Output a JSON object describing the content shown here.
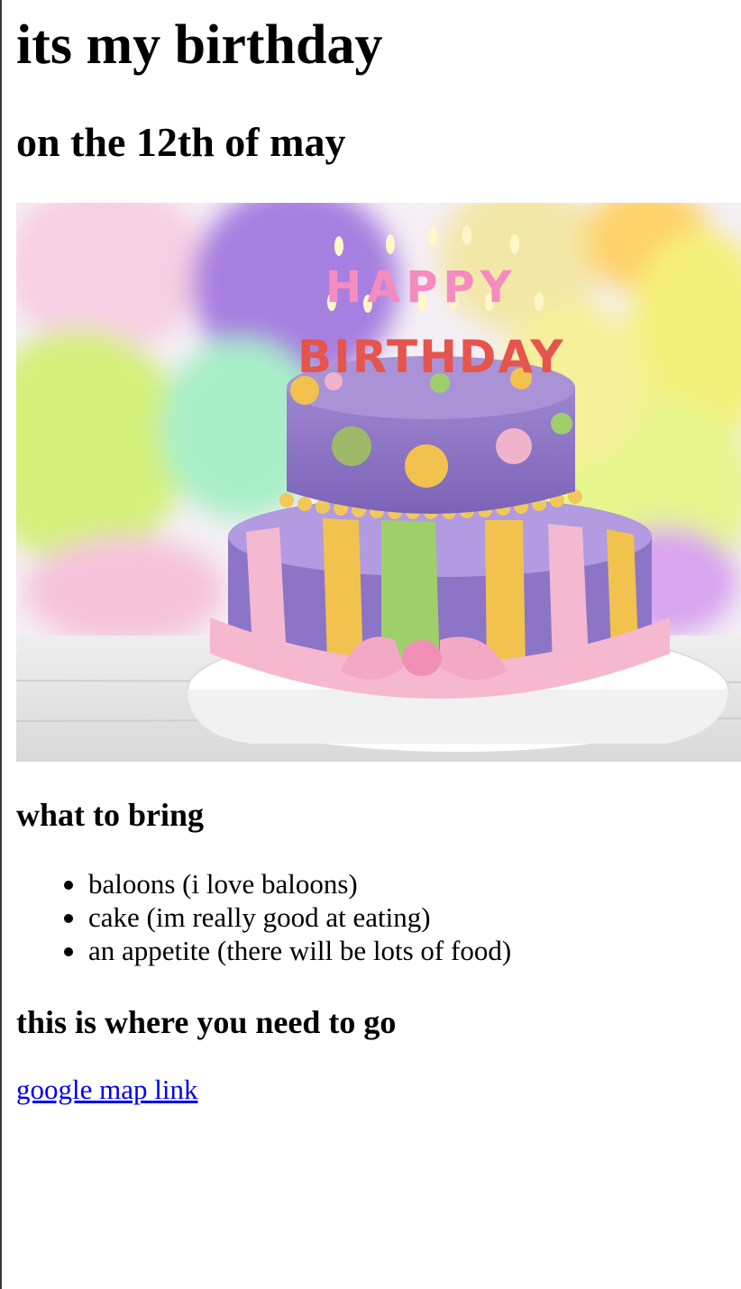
{
  "page": {
    "heading": "its my birthday",
    "subheading": "on the 12th of may"
  },
  "hero_image": {
    "icon": "birthday-cake-photo",
    "alt": "",
    "cake_topper_top": "HAPPY",
    "cake_topper_bottom": "BIRTHDAY"
  },
  "bring": {
    "heading": "what to bring",
    "items": [
      "baloons (i love baloons)",
      "cake (im really good at eating)",
      "an appetite (there will be lots of food)"
    ]
  },
  "directions": {
    "heading": "this is where you need to go",
    "link_label": "google map link"
  },
  "colors": {
    "link": "#0000ee",
    "text": "#000000",
    "background": "#ffffff"
  }
}
